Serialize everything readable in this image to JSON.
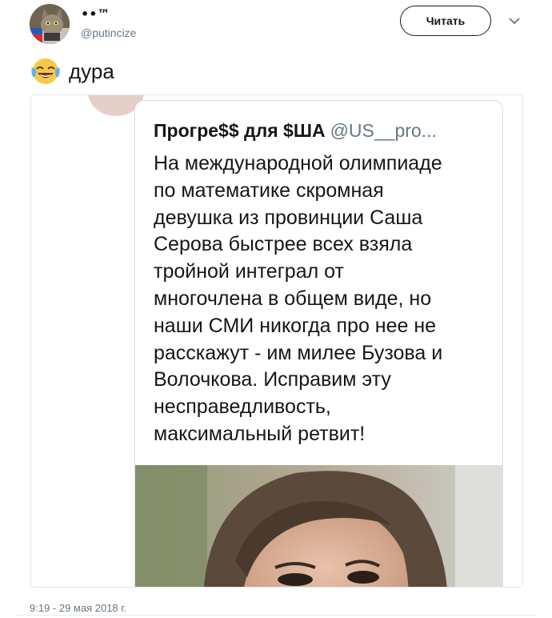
{
  "author": {
    "display_name": "••™",
    "handle": "@putincize",
    "avatar_icon": "cat-avatar-icon"
  },
  "follow_button": {
    "label": "Читать"
  },
  "menu_icon": "chevron-down-icon",
  "tweet": {
    "emoji": "face-with-tears-of-joy-icon",
    "text": "дура"
  },
  "quoted": {
    "name": "Прогре$$ для $ША",
    "handle": "@US__pro...",
    "body": "На международной олимпиаде\nпо математике скромная\nдевушка из провинции Саша\nСерова быстрее всех взяла\nтройной интеграл от\nмногочлена в общем виде, но\nнаши СМИ никогда про нее не\nрасскажут - им милее Бузова и\nВолочкова. Исправим эту\nнесправедливость,\nмаксимальный ретвит!",
    "photo": "woman-portrait-photo"
  },
  "timestamp": "9:19 - 29 мая 2018 г.",
  "colors": {
    "text": "#14171a",
    "muted": "#657786",
    "border": "#e1e8ed"
  }
}
